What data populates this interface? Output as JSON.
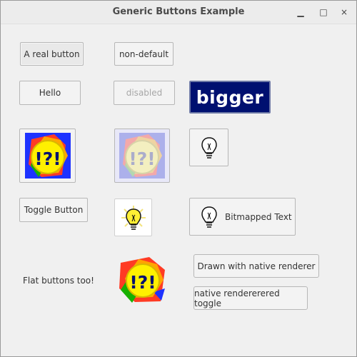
{
  "window": {
    "title": "Generic Buttons Example",
    "controls": [
      "minimize-icon",
      "maximize-icon",
      "close-icon"
    ]
  },
  "buttons": {
    "real_button": "A real button",
    "non_default": "non-default",
    "hello": "Hello",
    "disabled": "disabled",
    "bigger": "bigger",
    "toggle_button": "Toggle Button",
    "bitmapped_text": "Bitmapped Text",
    "native_renderer": "Drawn with native renderer",
    "native_toggle": "native rendererered toggle"
  },
  "labels": {
    "flat_buttons": "Flat buttons too!"
  },
  "icons": {
    "logo": "!?!",
    "bulb": "lightbulb-icon"
  },
  "colors": {
    "bigger_bg": "#001070",
    "bigger_text": "#ffffff",
    "logo_red": "#ff2d1f",
    "logo_green": "#17b000",
    "logo_blue": "#1427ff",
    "logo_yellow": "#fff000"
  }
}
